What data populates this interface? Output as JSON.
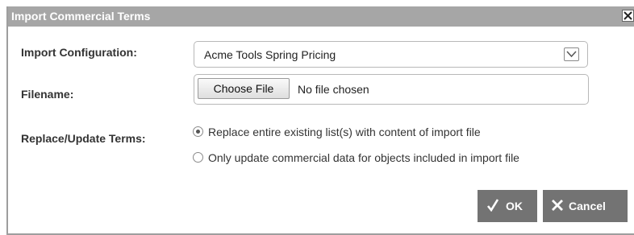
{
  "dialog": {
    "title": "Import Commercial Terms"
  },
  "form": {
    "import_configuration_label": "Import Configuration:",
    "import_configuration_value": "Acme Tools Spring Pricing",
    "filename_label": "Filename:",
    "choose_file_label": "Choose File",
    "no_file_text": "No file chosen",
    "replace_update_label": "Replace/Update Terms:",
    "options": [
      {
        "label": "Replace entire existing list(s) with content of import file",
        "selected": true
      },
      {
        "label": "Only update commercial data for objects included in import file",
        "selected": false
      }
    ]
  },
  "buttons": {
    "ok_label": "OK",
    "cancel_label": "Cancel"
  },
  "icons": {
    "close": "close-icon",
    "dropdown": "chevron-down-icon",
    "ok": "check-icon",
    "cancel": "x-icon"
  },
  "colors": {
    "titlebar": "#a6a6a6",
    "button": "#737373"
  }
}
